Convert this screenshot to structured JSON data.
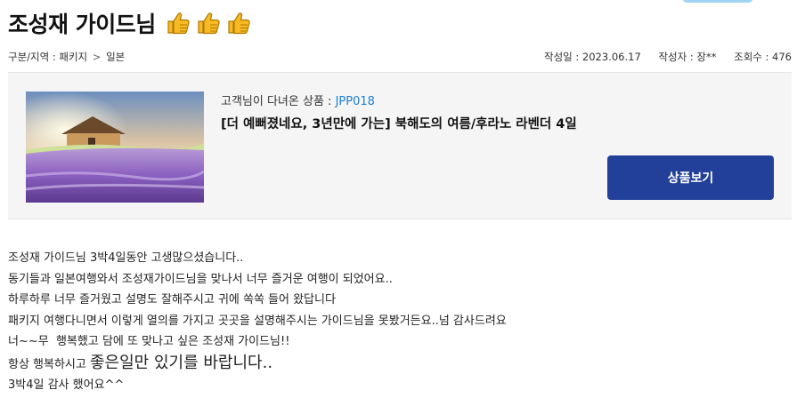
{
  "page": {
    "title": "조성재 가이드님",
    "thumb_icons": [
      "thumbs-up-icon",
      "thumbs-up-icon",
      "thumbs-up-icon"
    ]
  },
  "meta": {
    "category_label": "구분/지역 : ",
    "category": "패키지",
    "separator": ">",
    "region": "일본",
    "date": "작성일 : 2023.06.17",
    "author": "작성자 : 장**",
    "views": "조회수 : 476"
  },
  "product": {
    "label": "고객님이 다녀온 상품 : ",
    "code": "JPP018",
    "title": "[더 예뻐졌네요, 3년만에 가는] 북해도의 여름/후라노 라벤더 4일",
    "button_label": "상품보기"
  },
  "review": {
    "lines": [
      "조성재 가이드님 3박4일동안 고생많으셨습니다..",
      "동기들과 일본여행와서 조성재가이드님을 맞나서 너무 즐거운 여행이 되었어요..",
      "하루하루 너무 즐거웠고 설명도 잘해주시고 귀에 쏙쏙 들어 왔답니다",
      "패키지 여행다니면서 이렇게 열의를 가지고 곳곳을 설명해주시는 가이드님을 못봤거든요..넘 감사드려요",
      "너~~무  행복했고 담에 또 맞나고 싶은 조성재 가이드님!!"
    ],
    "line6_prefix": "항상 행복하시고 ",
    "line6_big": "좋은일만 있기를 바랍니다..",
    "line7": "3박4일 감사 했어요^^"
  },
  "colors": {
    "accent_blue": "#22409a",
    "code_blue": "#1e7fd1",
    "box_bg": "#f5f5f5",
    "thumb_yellow": "#f7b924"
  }
}
